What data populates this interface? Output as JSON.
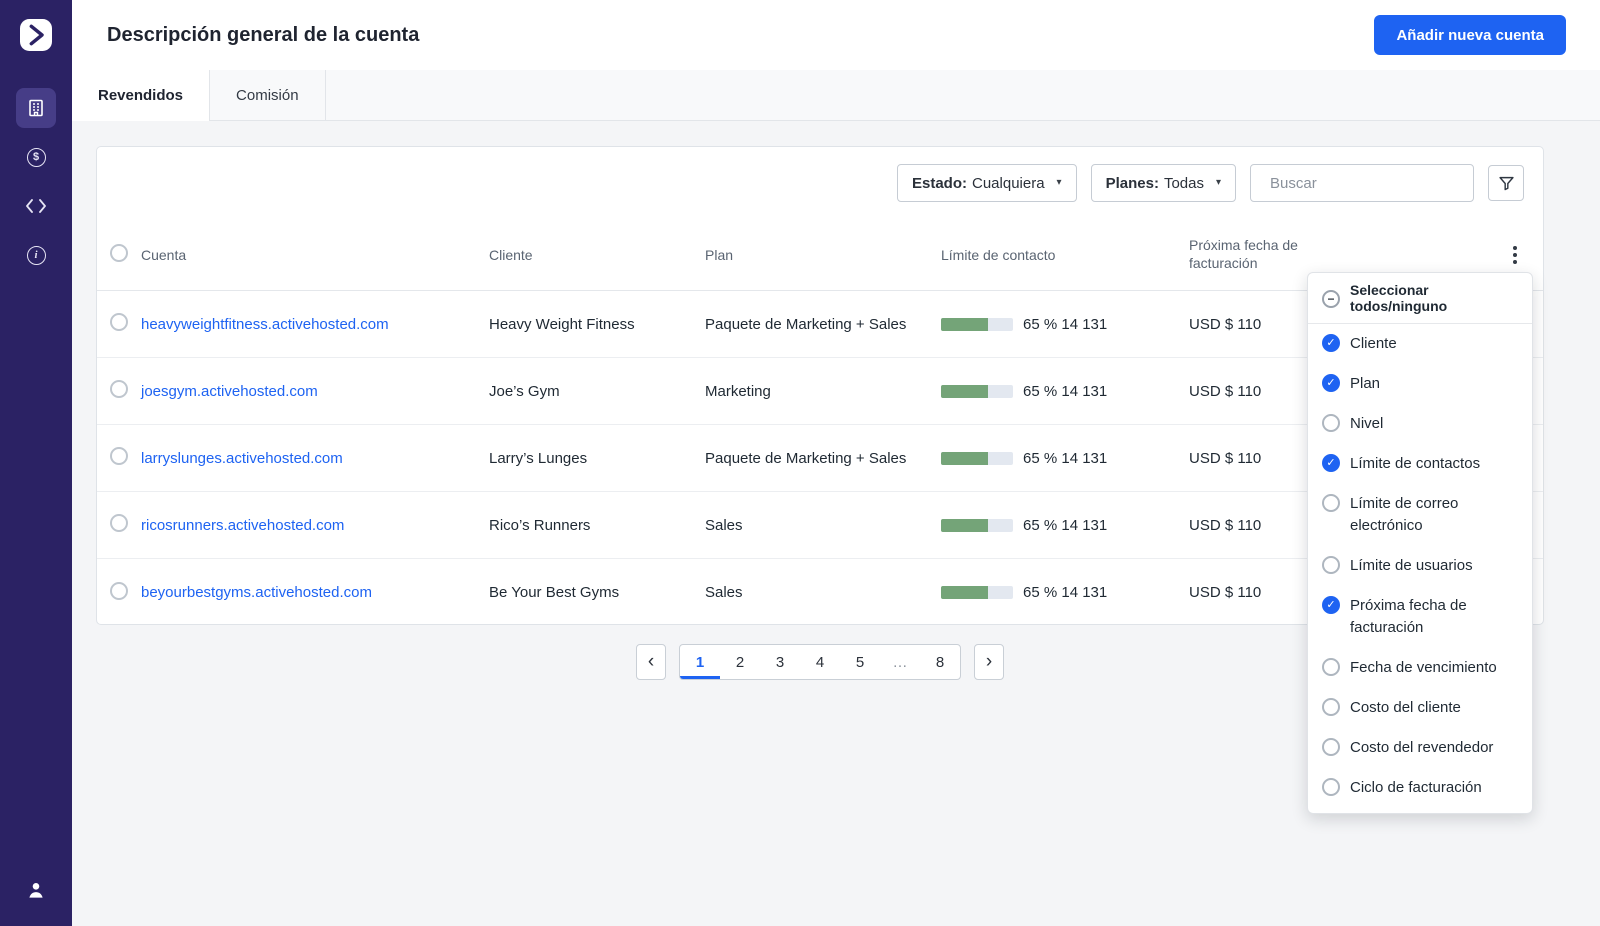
{
  "colors": {
    "accent_blue": "#1E63F2",
    "sidebar_purple": "#2B2264",
    "sidebar_active": "#463D87",
    "progress_green": "#74A478",
    "progress_track": "#E3E8F0"
  },
  "icons": {
    "check": "✓",
    "minus": "−",
    "caret_down": "▾",
    "chevron_left": "‹",
    "chevron_right": "›",
    "sidebar": [
      "activecampaign-logo",
      "building-icon",
      "dollar-circle-icon",
      "code-icon",
      "info-circle-icon",
      "person-icon"
    ],
    "other": [
      "search-icon",
      "funnel-icon",
      "kebab-icon"
    ]
  },
  "header": {
    "title": "Descripción general de la cuenta",
    "add_button": "Añadir nueva cuenta"
  },
  "tabs": [
    {
      "id": "revendidos",
      "label": "Revendidos",
      "active": true
    },
    {
      "id": "comision",
      "label": "Comisión",
      "active": false
    }
  ],
  "filters": {
    "estado_label": "Estado:",
    "estado_value": "Cualquiera",
    "planes_label": "Planes:",
    "planes_value": "Todas",
    "search_placeholder": "Buscar"
  },
  "table": {
    "columns": [
      "Cuenta",
      "Cliente",
      "Plan",
      "Límite de contacto",
      "Próxima fecha de facturación"
    ],
    "rows": [
      {
        "account": "heavyweightfitness.activehosted.com",
        "client": "Heavy Weight Fitness",
        "plan": "Paquete de Marketing + Sales",
        "contact_pct": 65,
        "contact_label": "65 % 14 131",
        "billing": "USD $ 110"
      },
      {
        "account": "joesgym.activehosted.com",
        "client": "Joe’s Gym",
        "plan": "Marketing",
        "contact_pct": 65,
        "contact_label": "65 % 14 131",
        "billing": "USD $ 110"
      },
      {
        "account": "larryslunges.activehosted.com",
        "client": "Larry’s Lunges",
        "plan": "Paquete de Marketing + Sales",
        "contact_pct": 65,
        "contact_label": "65 % 14 131",
        "billing": "USD $ 110"
      },
      {
        "account": "ricosrunners.activehosted.com",
        "client": "Rico’s Runners",
        "plan": "Sales",
        "contact_pct": 65,
        "contact_label": "65 % 14 131",
        "billing": "USD $ 110"
      },
      {
        "account": "beyourbestgyms.activehosted.com",
        "client": "Be Your Best Gyms",
        "plan": "Sales",
        "contact_pct": 65,
        "contact_label": "65 % 14 131",
        "billing": "USD $ 110"
      }
    ]
  },
  "pagination": {
    "pages": [
      "1",
      "2",
      "3",
      "4",
      "5",
      "…",
      "8"
    ],
    "active": "1"
  },
  "column_menu": {
    "select_all": "Seleccionar todos/ninguno",
    "items": [
      {
        "label": "Cliente",
        "checked": true
      },
      {
        "label": "Plan",
        "checked": true
      },
      {
        "label": "Nivel",
        "checked": false
      },
      {
        "label": "Límite de contactos",
        "checked": true
      },
      {
        "label": "Límite de correo electrónico",
        "checked": false
      },
      {
        "label": "Límite de usuarios",
        "checked": false
      },
      {
        "label": "Próxima fecha de facturación",
        "checked": true
      },
      {
        "label": "Fecha de vencimiento",
        "checked": false
      },
      {
        "label": "Costo del cliente",
        "checked": false
      },
      {
        "label": "Costo del revendedor",
        "checked": false
      },
      {
        "label": "Ciclo de facturación",
        "checked": false
      }
    ]
  }
}
